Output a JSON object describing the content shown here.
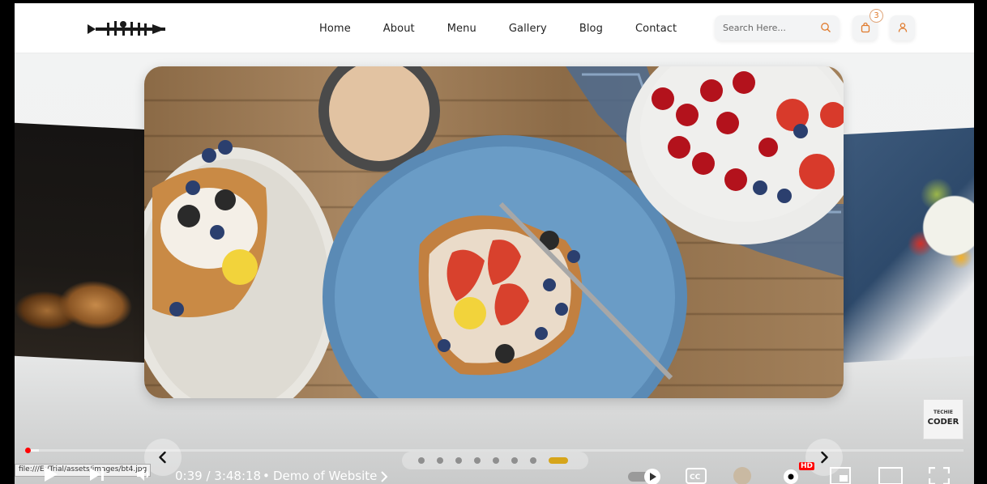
{
  "nav": {
    "links": [
      "Home",
      "About",
      "Menu",
      "Gallery",
      "Blog",
      "Contact"
    ],
    "search_placeholder": "Search Here...",
    "cart_count": "3",
    "icons": {
      "search": "search-icon",
      "cart": "bag-icon",
      "user": "user-icon"
    },
    "accent_color": "#e07a2c"
  },
  "carousel": {
    "dots_count": 7,
    "active_dot": 7,
    "prev_icon": "chevron-left-icon",
    "next_icon": "chevron-right-icon"
  },
  "video_player": {
    "tooltip": "file:///E:/Trial/assets/images/bt4.jpg",
    "current_time": "0:39",
    "duration": "3:48:18",
    "time_display": "0:39 / 3:48:18",
    "chapter_title": "Demo of Website",
    "quality_badge": "HD",
    "progress_color": "#ff0000"
  },
  "watermark": {
    "line1": "TECHIE",
    "line2": "CODER"
  }
}
